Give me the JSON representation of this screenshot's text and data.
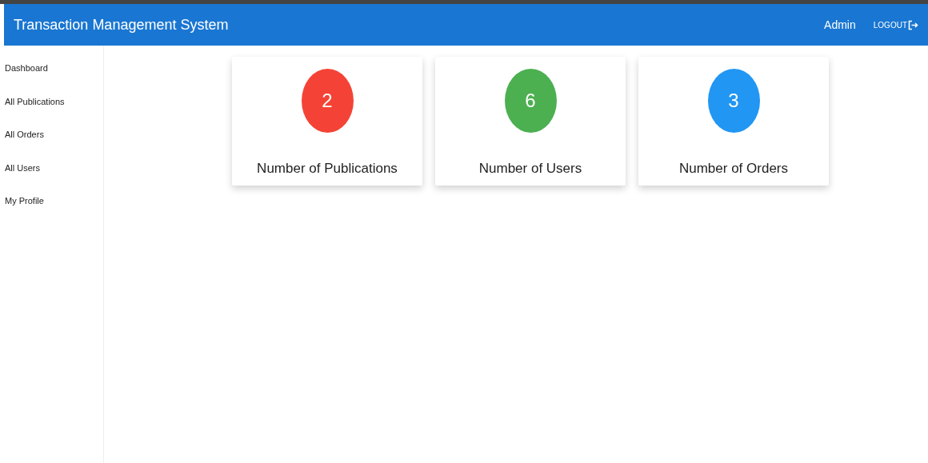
{
  "header": {
    "title": "Transaction Management System",
    "user": "Admin",
    "logout": "LOGOUT"
  },
  "sidebar": {
    "items": [
      {
        "label": "Dashboard"
      },
      {
        "label": "All Publications"
      },
      {
        "label": "All Orders"
      },
      {
        "label": "All Users"
      },
      {
        "label": "My Profile"
      }
    ]
  },
  "stats": [
    {
      "value": "2",
      "label": "Number of Publications",
      "color": "#f44336"
    },
    {
      "value": "6",
      "label": "Number of Users",
      "color": "#4caf50"
    },
    {
      "value": "3",
      "label": "Number of Orders",
      "color": "#2196f3"
    }
  ]
}
